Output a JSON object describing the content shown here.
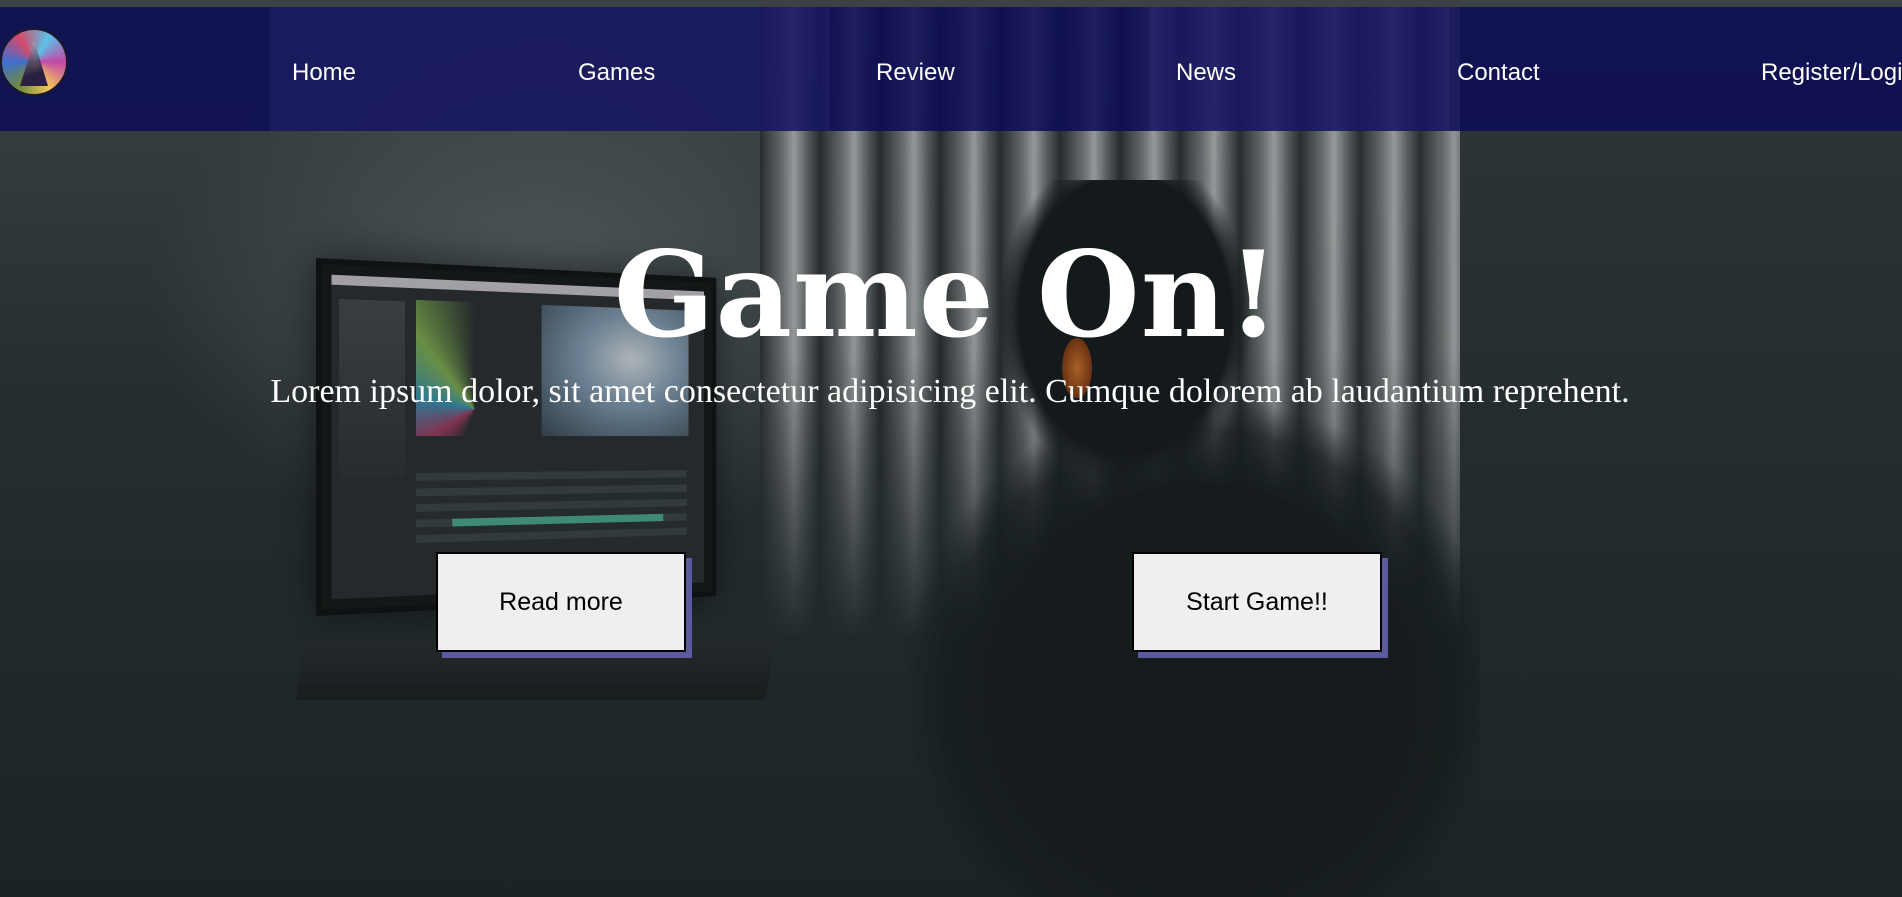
{
  "brand": {
    "logo_icon": "circular-logo-icon"
  },
  "nav": {
    "items": [
      {
        "label": "Home"
      },
      {
        "label": "Games"
      },
      {
        "label": "Review"
      },
      {
        "label": "News"
      },
      {
        "label": "Contact"
      },
      {
        "label": "Register/Logi"
      }
    ]
  },
  "hero": {
    "title": "Game On!",
    "subtitle": "Lorem ipsum dolor, sit amet consectetur adipisicing elit. Cumque dolorem ab laudantium reprehent.",
    "buttons": {
      "read_more": "Read more",
      "start_game": "Start Game!!"
    }
  },
  "colors": {
    "navbar_bg": "#0e0c54",
    "text": "#ffffff",
    "button_bg": "#efefef",
    "button_shadow": "#5a5a9c"
  }
}
